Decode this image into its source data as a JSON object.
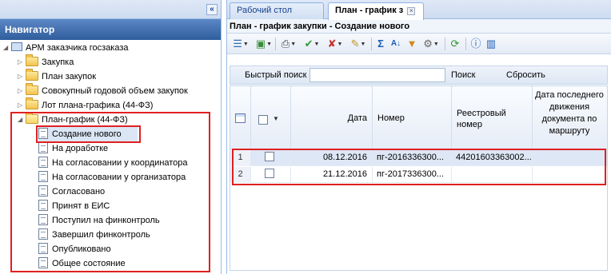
{
  "nav": {
    "collapse_icon": "«",
    "header": "Навигатор",
    "root": "АРМ заказчика госзаказа",
    "items": [
      {
        "label": "Закупка"
      },
      {
        "label": "План закупок"
      },
      {
        "label": "Совокупный годовой объем закупок"
      },
      {
        "label": "Лот плана-графика (44-ФЗ)"
      },
      {
        "label": "План-график (44-ФЗ)"
      }
    ],
    "children": [
      {
        "label": "Создание нового"
      },
      {
        "label": "На доработке"
      },
      {
        "label": "На согласовании у координатора"
      },
      {
        "label": "На согласовании у организатора"
      },
      {
        "label": "Согласовано"
      },
      {
        "label": "Принят в ЕИС"
      },
      {
        "label": "Поступил на финконтроль"
      },
      {
        "label": "Завершил финконтроль"
      },
      {
        "label": "Опубликовано"
      },
      {
        "label": "Общее состояние"
      }
    ]
  },
  "tabs": [
    {
      "label": "Рабочий стол"
    },
    {
      "label": "План - график з",
      "close": "×"
    }
  ],
  "panel_title": "План - график закупки - Создание нового",
  "search": {
    "label": "Быстрый поиск",
    "value": "",
    "search_button": "Поиск",
    "reset_button": "Сбросить"
  },
  "grid": {
    "columns": {
      "date": "Дата",
      "number": "Номер",
      "registry": "Реестровый номер",
      "last_move": "Дата последнего движения документа по маршруту"
    },
    "rows": [
      {
        "num": "1",
        "date": "08.12.2016",
        "number": "пг-2016336300...",
        "registry": "44201603363002...",
        "last_move": ""
      },
      {
        "num": "2",
        "date": "21.12.2016",
        "number": "пг-2017336300...",
        "registry": "",
        "last_move": ""
      }
    ]
  },
  "colors": {
    "highlight": "#e02020",
    "nav_header": "#2f5d9c",
    "row_alt": "#dde7f5"
  }
}
